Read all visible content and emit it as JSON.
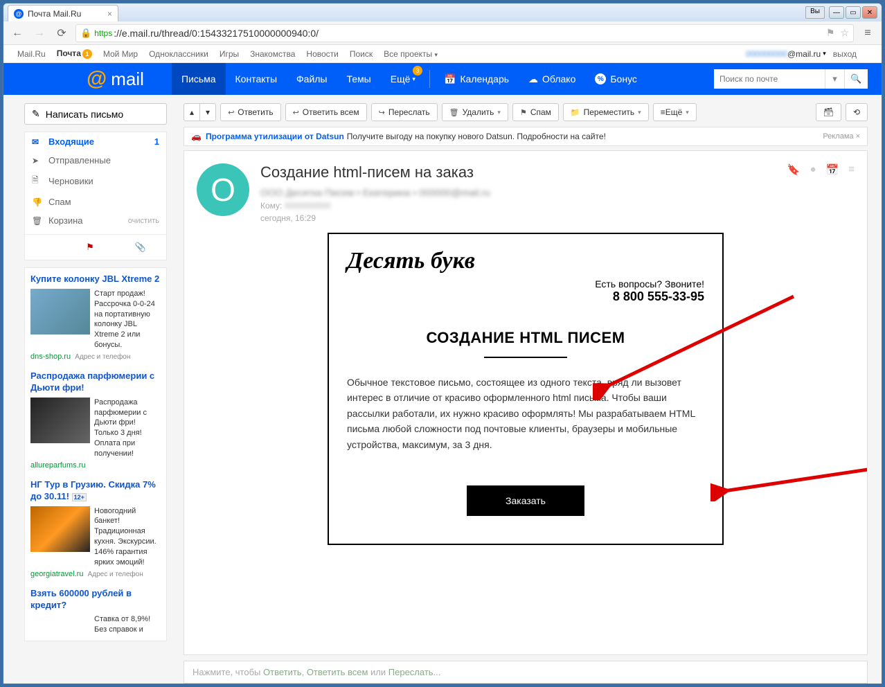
{
  "browser": {
    "tab_title": "Почта Mail.Ru",
    "url_https": "https",
    "url_rest": "://e.mail.ru/thread/0:15433217510000000940:0/",
    "titlebar_user": "Вы"
  },
  "portal": {
    "items": [
      "Mail.Ru",
      "Почта",
      "Мой Мир",
      "Одноклассники",
      "Игры",
      "Знакомства",
      "Новости",
      "Поиск",
      "Все проекты"
    ],
    "badge": "1",
    "email_user_blur": "000000000",
    "email_domain": "@mail.ru",
    "logout": "выход"
  },
  "header": {
    "logo": "mail",
    "nav": [
      {
        "label": "Письма",
        "active": true
      },
      {
        "label": "Контакты"
      },
      {
        "label": "Файлы"
      },
      {
        "label": "Темы"
      },
      {
        "label": "Ещё",
        "badge": "3"
      },
      {
        "label": "Календарь",
        "icon": "📅",
        "day": "27"
      },
      {
        "label": "Облако",
        "icon": "☁"
      },
      {
        "label": "Бонус",
        "icon": "%"
      }
    ],
    "search_placeholder": "Поиск по почте"
  },
  "compose": "Написать письмо",
  "folders": [
    {
      "icon": "✉",
      "label": "Входящие",
      "count": "1",
      "active": true
    },
    {
      "icon": "➤",
      "label": "Отправленные"
    },
    {
      "icon": "🗎",
      "label": "Черновики"
    },
    {
      "icon": "👎",
      "label": "Спам"
    },
    {
      "icon": "🗑",
      "label": "Корзина",
      "clear": "очистить"
    }
  ],
  "ads": [
    {
      "title": "Купите колонку JBL Xtreme 2",
      "text": "Старт продаж! Рассрочка 0-0-24 на портативную колонку JBL Xtreme 2 или бонусы.",
      "domain": "dns-shop.ru",
      "addr": "Адрес и телефон",
      "img": "a1"
    },
    {
      "title": "Распродажа парфюмерии с Дьюти фри!",
      "text": "Распродажа парфюмерии с Дьюти фри! Только 3 дня! Оплата при получении!",
      "domain": "allureparfums.ru",
      "img": "a2"
    },
    {
      "title": "НГ Тур в Грузию. Скидка 7% до 30.11!",
      "age": "12+",
      "text": "Новогодний банкет! Традиционная кухня. Экскурсии. 146% гарантия ярких эмоций!",
      "domain": "georgiatravel.ru",
      "addr": "Адрес и телефон",
      "img": "a3"
    },
    {
      "title": "Взять 600000 рублей в кредит?",
      "text": "Ставка от 8,9%! Без справок и",
      "domain": "",
      "img": "a4"
    }
  ],
  "toolbar": {
    "reply": "Ответить",
    "reply_all": "Ответить всем",
    "forward": "Переслать",
    "delete": "Удалить",
    "spam": "Спам",
    "move": "Переместить",
    "more": "Ещё"
  },
  "promo": {
    "link": "Программа утилизации от Datsun",
    "text": "Получите выгоду на покупку нового Datsun. Подробности на сайте!",
    "label": "Реклама"
  },
  "message": {
    "avatar_letter": "О",
    "subject": "Создание html-писем на заказ",
    "from_blur": "ООО Десятка Писем • Екатерина • 000000@mail.ru",
    "to_prefix": "Кому:",
    "to_blur": "0000000000",
    "date": "сегодня, 16:29"
  },
  "email_body": {
    "brand": "Десять букв",
    "question": "Есть вопросы? Звоните!",
    "phone": "8 800 555-33-95",
    "title": "СОЗДАНИЕ HTML ПИСЕМ",
    "para": "Обычное текстовое письмо, состоящее из одного текста, вряд ли вызовет интерес в отличие от красиво оформленного html письма. Чтобы ваши рассылки работали, их нужно красиво оформлять! Мы разрабатываем HTML письма любой сложности под почтовые клиенты, браузеры и мобильные устройства, максимум, за 3 дня.",
    "cta": "Заказать"
  },
  "reply_hint": {
    "pre": "Нажмите, чтобы ",
    "r": "Ответить",
    "sep1": ", ",
    "ra": "Ответить всем",
    "sep2": " или ",
    "f": "Переслать",
    "dots": "..."
  }
}
